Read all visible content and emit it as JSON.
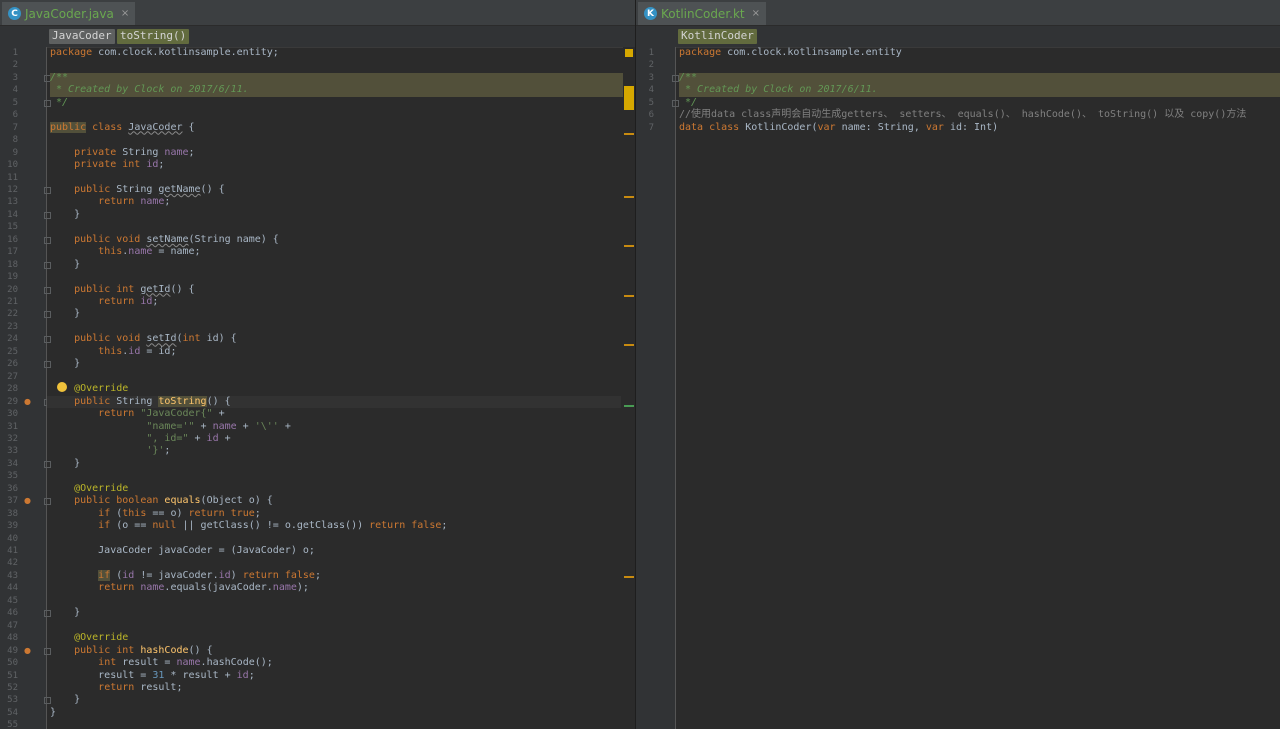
{
  "left": {
    "tab": {
      "icon": "C",
      "title": "JavaCoder.java",
      "close": "×"
    },
    "breadcrumbs": [
      "JavaCoder",
      "toString()"
    ],
    "line_count": 55,
    "lines": [
      [
        [
          "kw",
          "package"
        ],
        [
          "p",
          " com.clock.kotlinsample.entity;"
        ]
      ],
      [],
      [
        [
          "cmt",
          "/**"
        ]
      ],
      [
        [
          "cmt",
          " * Created by Clock on 2017/6/11."
        ]
      ],
      [
        [
          "cmt",
          " */"
        ]
      ],
      [],
      [
        [
          "kw hly",
          "public"
        ],
        [
          "p",
          " "
        ],
        [
          "kw",
          "class"
        ],
        [
          "p",
          " "
        ],
        [
          "und",
          "JavaCoder"
        ],
        [
          "p",
          " {"
        ]
      ],
      [],
      [
        [
          "p",
          "    "
        ],
        [
          "kw",
          "private"
        ],
        [
          "p",
          " String "
        ],
        [
          "fld",
          "name"
        ],
        [
          "p",
          ";"
        ]
      ],
      [
        [
          "p",
          "    "
        ],
        [
          "kw",
          "private int"
        ],
        [
          "p",
          " "
        ],
        [
          "fld",
          "id"
        ],
        [
          "p",
          ";"
        ]
      ],
      [],
      [
        [
          "p",
          "    "
        ],
        [
          "kw",
          "public"
        ],
        [
          "p",
          " String "
        ],
        [
          "und",
          "getName"
        ],
        [
          "p",
          "() {"
        ]
      ],
      [
        [
          "p",
          "        "
        ],
        [
          "kw",
          "return"
        ],
        [
          "p",
          " "
        ],
        [
          "fld",
          "name"
        ],
        [
          "p",
          ";"
        ]
      ],
      [
        [
          "p",
          "    }"
        ]
      ],
      [],
      [
        [
          "p",
          "    "
        ],
        [
          "kw",
          "public void"
        ],
        [
          "p",
          " "
        ],
        [
          "und",
          "setName"
        ],
        [
          "p",
          "(String name) {"
        ]
      ],
      [
        [
          "p",
          "        "
        ],
        [
          "kw",
          "this"
        ],
        [
          "p",
          "."
        ],
        [
          "fld",
          "name"
        ],
        [
          "p",
          " = name;"
        ]
      ],
      [
        [
          "p",
          "    }"
        ]
      ],
      [],
      [
        [
          "p",
          "    "
        ],
        [
          "kw",
          "public int"
        ],
        [
          "p",
          " "
        ],
        [
          "und",
          "getId"
        ],
        [
          "p",
          "() {"
        ]
      ],
      [
        [
          "p",
          "        "
        ],
        [
          "kw",
          "return"
        ],
        [
          "p",
          " "
        ],
        [
          "fld",
          "id"
        ],
        [
          "p",
          ";"
        ]
      ],
      [
        [
          "p",
          "    }"
        ]
      ],
      [],
      [
        [
          "p",
          "    "
        ],
        [
          "kw",
          "public void"
        ],
        [
          "p",
          " "
        ],
        [
          "und",
          "setId"
        ],
        [
          "p",
          "("
        ],
        [
          "kw",
          "int"
        ],
        [
          "p",
          " id) {"
        ]
      ],
      [
        [
          "p",
          "        "
        ],
        [
          "kw",
          "this"
        ],
        [
          "p",
          "."
        ],
        [
          "fld",
          "id"
        ],
        [
          "p",
          " = id;"
        ]
      ],
      [
        [
          "p",
          "    }"
        ]
      ],
      [],
      [
        [
          "p",
          "    "
        ],
        [
          "ann",
          "@Override"
        ]
      ],
      [
        [
          "p",
          "    "
        ],
        [
          "kw",
          "public"
        ],
        [
          "p",
          " String "
        ],
        [
          "fnm hly",
          "toString"
        ],
        [
          "p",
          "() {"
        ]
      ],
      [
        [
          "p",
          "        "
        ],
        [
          "kw",
          "return"
        ],
        [
          "p",
          " "
        ],
        [
          "str",
          "\"JavaCoder{\""
        ],
        [
          "p",
          " +"
        ]
      ],
      [
        [
          "p",
          "                "
        ],
        [
          "str",
          "\"name='\""
        ],
        [
          "p",
          " + "
        ],
        [
          "fld",
          "name"
        ],
        [
          "p",
          " + "
        ],
        [
          "str",
          "'\\''"
        ],
        [
          "p",
          " +"
        ]
      ],
      [
        [
          "p",
          "                "
        ],
        [
          "str",
          "\", id=\""
        ],
        [
          "p",
          " + "
        ],
        [
          "fld",
          "id"
        ],
        [
          "p",
          " +"
        ]
      ],
      [
        [
          "p",
          "                "
        ],
        [
          "str",
          "'}'"
        ],
        [
          "p",
          ";"
        ]
      ],
      [
        [
          "p",
          "    }"
        ]
      ],
      [],
      [
        [
          "p",
          "    "
        ],
        [
          "ann",
          "@Override"
        ]
      ],
      [
        [
          "p",
          "    "
        ],
        [
          "kw",
          "public boolean"
        ],
        [
          "p",
          " "
        ],
        [
          "fnm",
          "equals"
        ],
        [
          "p",
          "(Object o) {"
        ]
      ],
      [
        [
          "p",
          "        "
        ],
        [
          "kw",
          "if"
        ],
        [
          "p",
          " ("
        ],
        [
          "kw",
          "this"
        ],
        [
          "p",
          " == o) "
        ],
        [
          "kw",
          "return true"
        ],
        [
          "p",
          ";"
        ]
      ],
      [
        [
          "p",
          "        "
        ],
        [
          "kw",
          "if"
        ],
        [
          "p",
          " (o == "
        ],
        [
          "kw",
          "null"
        ],
        [
          "p",
          " || getClass() != o.getClass()) "
        ],
        [
          "kw",
          "return false"
        ],
        [
          "p",
          ";"
        ]
      ],
      [],
      [
        [
          "p",
          "        JavaCoder javaCoder = (JavaCoder) o;"
        ]
      ],
      [],
      [
        [
          "p",
          "        "
        ],
        [
          "kw hly",
          "if"
        ],
        [
          "p",
          " ("
        ],
        [
          "fld",
          "id"
        ],
        [
          "p",
          " != javaCoder."
        ],
        [
          "fld",
          "id"
        ],
        [
          "p",
          ") "
        ],
        [
          "kw",
          "return false"
        ],
        [
          "p",
          ";"
        ]
      ],
      [
        [
          "p",
          "        "
        ],
        [
          "kw",
          "return"
        ],
        [
          "p",
          " "
        ],
        [
          "fld",
          "name"
        ],
        [
          "p",
          ".equals(javaCoder."
        ],
        [
          "fld",
          "name"
        ],
        [
          "p",
          ");"
        ]
      ],
      [],
      [
        [
          "p",
          "    }"
        ]
      ],
      [],
      [
        [
          "p",
          "    "
        ],
        [
          "ann",
          "@Override"
        ]
      ],
      [
        [
          "p",
          "    "
        ],
        [
          "kw",
          "public int"
        ],
        [
          "p",
          " "
        ],
        [
          "fnm",
          "hashCode"
        ],
        [
          "p",
          "() {"
        ]
      ],
      [
        [
          "p",
          "        "
        ],
        [
          "kw",
          "int"
        ],
        [
          "p",
          " result = "
        ],
        [
          "fld",
          "name"
        ],
        [
          "p",
          ".hashCode();"
        ]
      ],
      [
        [
          "p",
          "        result = "
        ],
        [
          "num",
          "31"
        ],
        [
          "p",
          " * result + "
        ],
        [
          "fld",
          "id"
        ],
        [
          "p",
          ";"
        ]
      ],
      [
        [
          "p",
          "        "
        ],
        [
          "kw",
          "return"
        ],
        [
          "p",
          " result;"
        ]
      ],
      [
        [
          "p",
          "    }"
        ]
      ],
      [
        [
          "p",
          "}"
        ]
      ],
      []
    ],
    "icons": {
      "override_gutter": "override-marker-icon",
      "intention": "lightbulb-icon"
    }
  },
  "right": {
    "tab": {
      "icon": "K",
      "title": "KotlinCoder.kt",
      "close": "×"
    },
    "breadcrumbs": [
      "KotlinCoder"
    ],
    "line_count": 7,
    "lines": [
      [
        [
          "kw",
          "package"
        ],
        [
          "p",
          " com.clock.kotlinsample.entity"
        ]
      ],
      [],
      [
        [
          "cmt",
          "/**"
        ]
      ],
      [
        [
          "cmt",
          " * Created by Clock on 2017/6/11."
        ]
      ],
      [
        [
          "cmt",
          " */"
        ]
      ],
      [
        [
          "lc",
          "//使用data class声明会自动生成getters、 setters、 equals()、 hashCode()、 toString() 以及 copy()方法"
        ]
      ],
      [
        [
          "kw",
          "data class"
        ],
        [
          "p",
          " KotlinCoder("
        ],
        [
          "kw",
          "var"
        ],
        [
          "p",
          " name: String, "
        ],
        [
          "kw",
          "var"
        ],
        [
          "p",
          " id: Int)"
        ]
      ]
    ]
  },
  "colors": {
    "background": "#2b2b2b",
    "keyword": "#cc7832",
    "string": "#6a8759",
    "field": "#9876aa",
    "annotation": "#bbb529",
    "doc_comment": "#629755",
    "tab_text": "#6aa84f"
  }
}
